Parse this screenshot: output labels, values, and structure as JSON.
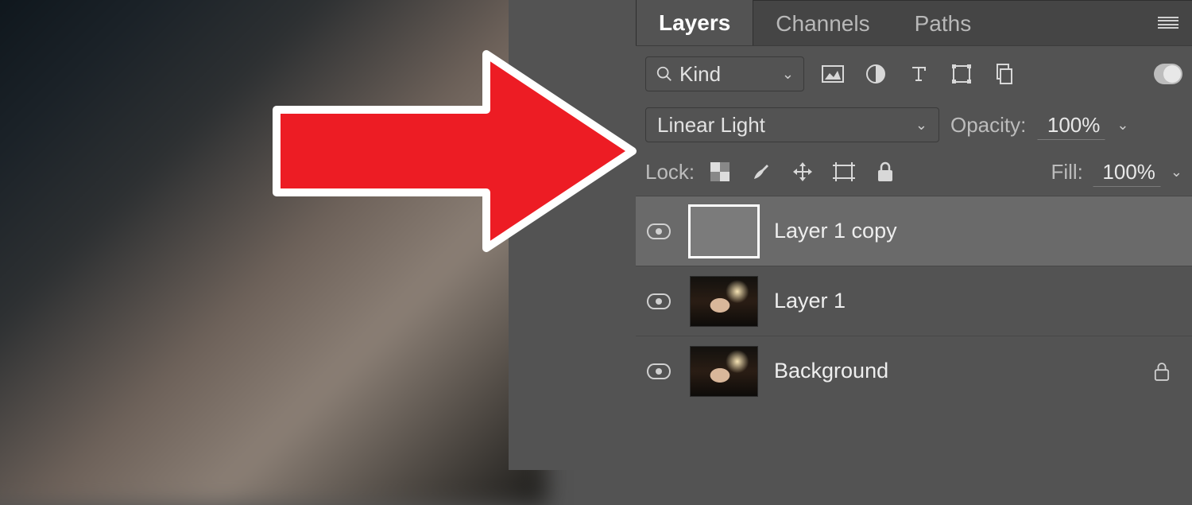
{
  "tabs": {
    "layers": "Layers",
    "channels": "Channels",
    "paths": "Paths"
  },
  "filter": {
    "kind_label": "Kind"
  },
  "blend": {
    "mode": "Linear Light",
    "opacity_label": "Opacity:",
    "opacity_value": "100%"
  },
  "lock": {
    "label": "Lock:",
    "fill_label": "Fill:",
    "fill_value": "100%"
  },
  "layers": [
    {
      "name": "Layer 1 copy",
      "selected": true,
      "thumb": "gray",
      "locked": false
    },
    {
      "name": "Layer 1",
      "selected": false,
      "thumb": "image",
      "locked": false
    },
    {
      "name": "Background",
      "selected": false,
      "thumb": "image",
      "locked": true
    }
  ],
  "icons": {
    "search": "search-icon",
    "image": "image-icon",
    "adjust": "adjust-icon",
    "type": "type-icon",
    "shape": "shape-icon",
    "smart": "smartobject-icon",
    "checker": "transparency-icon",
    "brush": "brush-icon",
    "move": "move-icon",
    "artboard": "artboard-icon",
    "lock": "lock-icon"
  }
}
